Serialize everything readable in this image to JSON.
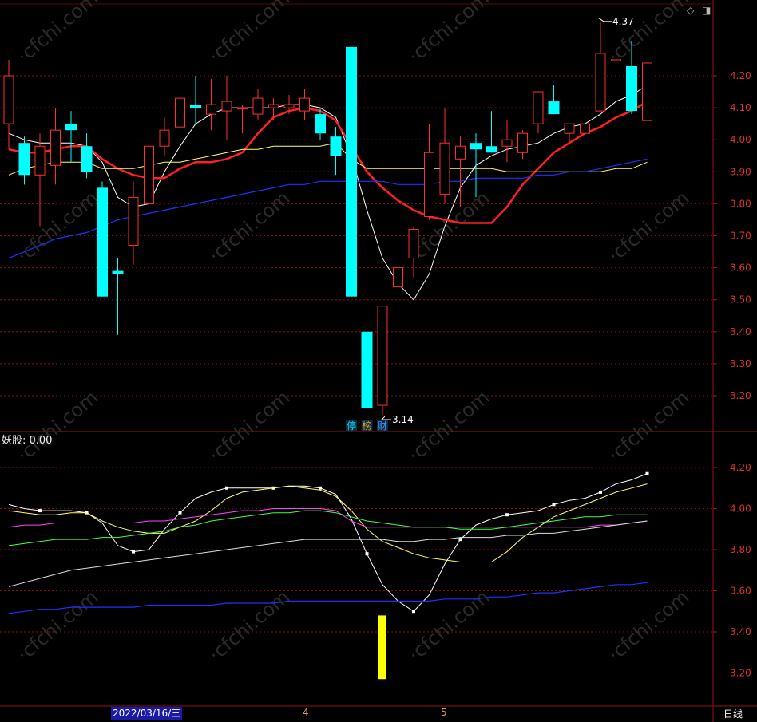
{
  "indicator": {
    "name": "妖股",
    "value": "0.00",
    "label_text": "妖股: 0.00"
  },
  "x_axis": {
    "current_date": "2022/03/16/三",
    "month_marks": [
      "4",
      "5"
    ]
  },
  "period_label": "日线",
  "events": [
    {
      "index": 22,
      "text": "停",
      "color": "#00e0e0"
    },
    {
      "index": 23,
      "text": "榜",
      "color": "#e0a020"
    },
    {
      "index": 24,
      "text": "财",
      "color": "#4a90e0"
    }
  ],
  "chart_data": [
    {
      "type": "candlestick",
      "title": "",
      "y_ticks": [
        "4.20",
        "4.10",
        "4.00",
        "3.90",
        "3.80",
        "3.70",
        "3.60",
        "3.50",
        "3.40",
        "3.30",
        "3.20"
      ],
      "ylim": [
        3.11,
        4.47
      ],
      "annotations": {
        "high_label": "4.37",
        "low_label": "3.14"
      },
      "candles": [
        {
          "o": 4.05,
          "h": 4.25,
          "l": 3.97,
          "c": 4.2
        },
        {
          "o": 3.99,
          "h": 4.01,
          "l": 3.86,
          "c": 3.89
        },
        {
          "o": 3.89,
          "h": 4.02,
          "l": 3.73,
          "c": 3.98
        },
        {
          "o": 3.92,
          "h": 4.1,
          "l": 3.86,
          "c": 4.03
        },
        {
          "o": 4.05,
          "h": 4.09,
          "l": 3.93,
          "c": 4.03
        },
        {
          "o": 3.98,
          "h": 4.02,
          "l": 3.88,
          "c": 3.9
        },
        {
          "o": 3.85,
          "h": 3.87,
          "l": 3.51,
          "c": 3.51
        },
        {
          "o": 3.59,
          "h": 3.63,
          "l": 3.39,
          "c": 3.58
        },
        {
          "o": 3.67,
          "h": 3.87,
          "l": 3.61,
          "c": 3.82
        },
        {
          "o": 3.8,
          "h": 4.0,
          "l": 3.78,
          "c": 3.98
        },
        {
          "o": 3.98,
          "h": 4.07,
          "l": 3.95,
          "c": 4.03
        },
        {
          "o": 4.04,
          "h": 4.13,
          "l": 4.0,
          "c": 4.13
        },
        {
          "o": 4.11,
          "h": 4.2,
          "l": 4.05,
          "c": 4.1
        },
        {
          "o": 4.08,
          "h": 4.19,
          "l": 4.03,
          "c": 4.11
        },
        {
          "o": 4.09,
          "h": 4.2,
          "l": 4.0,
          "c": 4.12
        },
        {
          "o": 4.1,
          "h": 4.11,
          "l": 4.02,
          "c": 4.1
        },
        {
          "o": 4.08,
          "h": 4.16,
          "l": 4.06,
          "c": 4.13
        },
        {
          "o": 4.1,
          "h": 4.13,
          "l": 4.06,
          "c": 4.11
        },
        {
          "o": 4.1,
          "h": 4.14,
          "l": 4.08,
          "c": 4.11
        },
        {
          "o": 4.09,
          "h": 4.16,
          "l": 4.06,
          "c": 4.13
        },
        {
          "o": 4.08,
          "h": 4.1,
          "l": 4.0,
          "c": 4.02
        },
        {
          "o": 4.01,
          "h": 4.04,
          "l": 3.89,
          "c": 3.95
        },
        {
          "o": 4.29,
          "h": 4.29,
          "l": 3.51,
          "c": 3.51
        },
        {
          "o": 3.4,
          "h": 3.48,
          "l": 3.16,
          "c": 3.16
        },
        {
          "o": 3.17,
          "h": 3.48,
          "l": 3.14,
          "c": 3.48
        },
        {
          "o": 3.54,
          "h": 3.66,
          "l": 3.49,
          "c": 3.6
        },
        {
          "o": 3.63,
          "h": 3.73,
          "l": 3.57,
          "c": 3.72
        },
        {
          "o": 3.76,
          "h": 4.05,
          "l": 3.75,
          "c": 3.96
        },
        {
          "o": 3.83,
          "h": 4.1,
          "l": 3.8,
          "c": 3.99
        },
        {
          "o": 3.94,
          "h": 4.01,
          "l": 3.79,
          "c": 3.98
        },
        {
          "o": 3.99,
          "h": 4.02,
          "l": 3.82,
          "c": 3.97
        },
        {
          "o": 3.98,
          "h": 4.09,
          "l": 3.96,
          "c": 3.96
        },
        {
          "o": 3.98,
          "h": 4.06,
          "l": 3.93,
          "c": 4.0
        },
        {
          "o": 3.96,
          "h": 4.03,
          "l": 3.94,
          "c": 4.02
        },
        {
          "o": 4.05,
          "h": 4.14,
          "l": 4.02,
          "c": 4.15
        },
        {
          "o": 4.12,
          "h": 4.17,
          "l": 4.08,
          "c": 4.08
        },
        {
          "o": 4.02,
          "h": 4.04,
          "l": 3.99,
          "c": 4.05
        },
        {
          "o": 4.02,
          "h": 4.08,
          "l": 3.94,
          "c": 4.05
        },
        {
          "o": 4.09,
          "h": 4.37,
          "l": 4.09,
          "c": 4.27
        },
        {
          "o": 4.25,
          "h": 4.34,
          "l": 4.24,
          "c": 4.25
        },
        {
          "o": 4.23,
          "h": 4.31,
          "l": 4.08,
          "c": 4.09
        },
        {
          "o": 4.06,
          "h": 4.24,
          "l": 4.06,
          "c": 4.24
        }
      ],
      "ma_lines": [
        {
          "color": "#ffffff",
          "width": 1,
          "values": [
            4.02,
            4.0,
            3.99,
            3.99,
            3.99,
            3.98,
            3.93,
            3.82,
            3.79,
            3.8,
            3.9,
            3.98,
            4.05,
            4.08,
            4.1,
            4.1,
            4.1,
            4.1,
            4.11,
            4.11,
            4.1,
            4.07,
            3.95,
            3.78,
            3.63,
            3.55,
            3.5,
            3.58,
            3.73,
            3.85,
            3.92,
            3.95,
            3.97,
            3.98,
            3.99,
            4.02,
            4.04,
            4.05,
            4.08,
            4.12,
            4.14,
            4.17
          ]
        },
        {
          "color": "#ff2020",
          "width": 2.5,
          "values": [
            3.97,
            3.96,
            3.96,
            3.97,
            3.98,
            3.98,
            3.94,
            3.91,
            3.89,
            3.88,
            3.88,
            3.91,
            3.93,
            3.93,
            3.94,
            3.96,
            4.02,
            4.07,
            4.09,
            4.1,
            4.09,
            4.06,
            3.98,
            3.9,
            3.85,
            3.81,
            3.78,
            3.76,
            3.75,
            3.74,
            3.74,
            3.74,
            3.79,
            3.86,
            3.91,
            3.96,
            3.99,
            4.02,
            4.04,
            4.07,
            4.09,
            4.12
          ]
        },
        {
          "color": "#ffff66",
          "width": 1,
          "values": [
            3.89,
            3.91,
            3.92,
            3.93,
            3.93,
            3.93,
            3.91,
            3.91,
            3.91,
            3.92,
            3.93,
            3.93,
            3.94,
            3.95,
            3.96,
            3.97,
            3.97,
            3.98,
            3.98,
            3.98,
            3.98,
            3.99,
            3.94,
            3.91,
            3.91,
            3.91,
            3.91,
            3.91,
            3.91,
            3.91,
            3.91,
            3.91,
            3.9,
            3.9,
            3.9,
            3.9,
            3.9,
            3.9,
            3.9,
            3.91,
            3.91,
            3.93
          ]
        },
        {
          "color": "#2030ff",
          "width": 1.2,
          "values": [
            3.63,
            3.65,
            3.67,
            3.69,
            3.7,
            3.71,
            3.73,
            3.75,
            3.76,
            3.77,
            3.78,
            3.79,
            3.8,
            3.81,
            3.82,
            3.83,
            3.84,
            3.85,
            3.86,
            3.86,
            3.87,
            3.87,
            3.87,
            3.87,
            3.87,
            3.86,
            3.86,
            3.86,
            3.87,
            3.87,
            3.88,
            3.88,
            3.88,
            3.88,
            3.89,
            3.89,
            3.9,
            3.9,
            3.91,
            3.92,
            3.93,
            3.94
          ]
        }
      ]
    },
    {
      "type": "line",
      "title": "",
      "y_ticks": [
        "4.20",
        "4.00",
        "3.80",
        "3.60",
        "3.40",
        "3.20"
      ],
      "ylim": [
        3.03,
        4.4
      ],
      "series": [
        {
          "color": "#ffffff",
          "width": 1,
          "marker_every": 3,
          "values": [
            4.02,
            4.0,
            3.99,
            3.99,
            3.99,
            3.98,
            3.93,
            3.82,
            3.79,
            3.8,
            3.9,
            3.98,
            4.05,
            4.08,
            4.1,
            4.1,
            4.1,
            4.1,
            4.11,
            4.11,
            4.1,
            4.07,
            3.95,
            3.78,
            3.63,
            3.55,
            3.5,
            3.58,
            3.73,
            3.85,
            3.92,
            3.95,
            3.97,
            3.98,
            3.99,
            4.02,
            4.04,
            4.05,
            4.08,
            4.12,
            4.14,
            4.17
          ]
        },
        {
          "color": "#ffff66",
          "width": 1,
          "values": [
            3.99,
            3.98,
            3.97,
            3.97,
            3.98,
            3.98,
            3.94,
            3.91,
            3.89,
            3.88,
            3.88,
            3.91,
            3.94,
            3.99,
            4.05,
            4.08,
            4.09,
            4.1,
            4.11,
            4.1,
            4.09,
            4.06,
            3.99,
            3.9,
            3.84,
            3.81,
            3.78,
            3.76,
            3.75,
            3.74,
            3.74,
            3.74,
            3.79,
            3.86,
            3.91,
            3.96,
            3.99,
            4.02,
            4.05,
            4.08,
            4.1,
            4.12
          ]
        },
        {
          "color": "#ff44ff",
          "width": 1,
          "values": [
            3.91,
            3.92,
            3.92,
            3.93,
            3.93,
            3.93,
            3.93,
            3.93,
            3.93,
            3.94,
            3.94,
            3.95,
            3.96,
            3.97,
            3.98,
            3.99,
            3.99,
            4.0,
            4.0,
            4.0,
            4.0,
            3.99,
            3.94,
            3.91,
            3.91,
            3.91,
            3.91,
            3.91,
            3.91,
            3.91,
            3.91,
            3.91,
            3.91,
            3.91,
            3.91,
            3.91,
            3.91,
            3.91,
            3.92,
            3.92,
            3.93,
            3.94
          ]
        },
        {
          "color": "#44ff44",
          "width": 1,
          "values": [
            3.82,
            3.83,
            3.84,
            3.85,
            3.85,
            3.85,
            3.86,
            3.86,
            3.87,
            3.88,
            3.89,
            3.91,
            3.92,
            3.94,
            3.95,
            3.96,
            3.97,
            3.98,
            3.98,
            3.99,
            3.99,
            3.98,
            3.96,
            3.94,
            3.93,
            3.92,
            3.91,
            3.91,
            3.91,
            3.9,
            3.9,
            3.9,
            3.91,
            3.92,
            3.93,
            3.94,
            3.95,
            3.96,
            3.96,
            3.97,
            3.97,
            3.97
          ]
        },
        {
          "color": "#dddddd",
          "width": 1,
          "values": [
            3.62,
            3.64,
            3.66,
            3.68,
            3.7,
            3.71,
            3.72,
            3.73,
            3.74,
            3.75,
            3.76,
            3.77,
            3.78,
            3.79,
            3.8,
            3.81,
            3.82,
            3.83,
            3.84,
            3.85,
            3.85,
            3.85,
            3.85,
            3.85,
            3.85,
            3.84,
            3.84,
            3.85,
            3.85,
            3.86,
            3.86,
            3.86,
            3.87,
            3.87,
            3.88,
            3.88,
            3.89,
            3.9,
            3.91,
            3.92,
            3.93,
            3.94
          ]
        },
        {
          "color": "#2030ff",
          "width": 1.2,
          "values": [
            3.49,
            3.5,
            3.51,
            3.51,
            3.52,
            3.52,
            3.52,
            3.52,
            3.52,
            3.53,
            3.53,
            3.53,
            3.53,
            3.53,
            3.54,
            3.54,
            3.54,
            3.54,
            3.55,
            3.55,
            3.55,
            3.55,
            3.55,
            3.55,
            3.55,
            3.55,
            3.55,
            3.55,
            3.56,
            3.56,
            3.56,
            3.57,
            3.57,
            3.58,
            3.59,
            3.59,
            3.6,
            3.61,
            3.62,
            3.63,
            3.63,
            3.64
          ]
        }
      ],
      "highlight_bars": [
        {
          "index": 24,
          "low": 3.17,
          "high": 3.48,
          "color": "#ffff00"
        }
      ]
    }
  ]
}
